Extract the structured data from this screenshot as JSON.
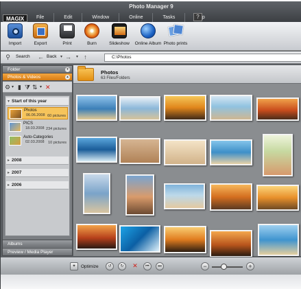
{
  "app": {
    "title": "Photo Manager 9",
    "logo": "MAGIX"
  },
  "menu": [
    "File",
    "Edit",
    "Window",
    "Online",
    "Tasks",
    "Help"
  ],
  "toolbar": [
    {
      "label": "Import",
      "icon": "camera-icon"
    },
    {
      "label": "Export",
      "icon": "export-icon"
    },
    {
      "label": "Print",
      "icon": "printer-icon"
    },
    {
      "label": "Burn",
      "icon": "burn-disc-icon"
    },
    {
      "label": "Slideshow",
      "icon": "slideshow-icon"
    },
    {
      "label": "Online Album",
      "icon": "globe-icon"
    },
    {
      "label": "Photo prints",
      "icon": "photo-prints-icon"
    }
  ],
  "nav": {
    "search": "Search",
    "back": "Back",
    "path": "C:\\Photos"
  },
  "sidebar": {
    "folder_tab": "Folder",
    "photos_videos_tab": "Photos & Videos",
    "groups": [
      "Start of this year",
      "2008",
      "2007",
      "2006"
    ],
    "albums": [
      {
        "name": "Photos",
        "date": "06.06.2008",
        "count": "60 pictures"
      },
      {
        "name": "PICS",
        "date": "18.03.2008",
        "count": "234 pictures"
      },
      {
        "name": "Auto-Categories",
        "date": "02.03.2008",
        "count": "10 pictures"
      }
    ],
    "albums_tab": "Albums",
    "preview_tab": "Preview / Media Player"
  },
  "main": {
    "folder_name": "Photos",
    "folder_count": "63 Files/Folders"
  },
  "bottom": {
    "optimize": "Optimize"
  },
  "colors": {
    "accent": "#e68a1c",
    "chrome_dark": "#3c3f43",
    "panel_grey": "#8a8d90"
  }
}
